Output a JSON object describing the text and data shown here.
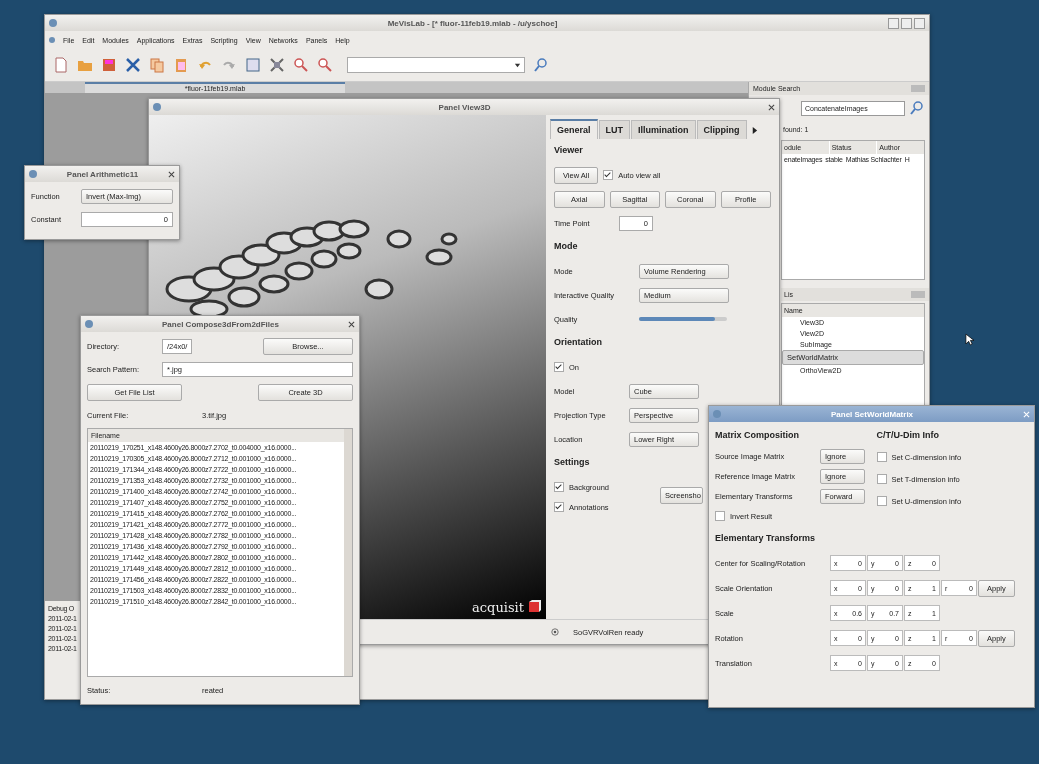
{
  "main_window": {
    "title": "MeVisLab - [* fluor-11feb19.mlab - /u/yschoe]",
    "menu": [
      "File",
      "Edit",
      "Modules",
      "Applications",
      "Extras",
      "Scripting",
      "View",
      "Networks",
      "Panels",
      "Help"
    ],
    "document_tab": "*fluor-11feb19.mlab",
    "debug_output": {
      "label": "Debug O",
      "lines": [
        "2011-02-1",
        "2011-02-1",
        "2011-02-1",
        "2011-02-1"
      ]
    }
  },
  "module_search": {
    "title": "Module Search",
    "query": "ConcatenateImages",
    "found": "found: 1",
    "columns": [
      "odule",
      "Status",
      "Author"
    ],
    "rows": [
      [
        "enateImages",
        "stable",
        "Mathias Schlachter",
        "H"
      ]
    ]
  },
  "module_list": {
    "title": "Lis",
    "columns": [
      "Name"
    ],
    "rows": [
      {
        "name": "View3D",
        "selected": false
      },
      {
        "name": "View2D",
        "selected": false
      },
      {
        "name": "SubImage",
        "selected": false
      },
      {
        "name": "SetWorldMatrix",
        "selected": true
      },
      {
        "name": "OrthoView2D",
        "selected": false
      }
    ]
  },
  "panel_view3d": {
    "title": "Panel View3D",
    "logo": "acquisit",
    "status": "SoGVRVolRen ready",
    "tabs": [
      {
        "label": "General",
        "selected": true
      },
      {
        "label": "LUT",
        "selected": false
      },
      {
        "label": "Illumination",
        "selected": false
      },
      {
        "label": "Clipping",
        "selected": false
      }
    ],
    "viewer": {
      "heading": "Viewer",
      "view_all": "View All",
      "auto_view_all": {
        "label": "Auto view all",
        "checked": true
      },
      "buttons": [
        "Axial",
        "Sagittal",
        "Coronal",
        "Profile"
      ],
      "time_point": {
        "label": "Time Point",
        "value": "0"
      }
    },
    "mode": {
      "heading": "Mode",
      "mode": {
        "label": "Mode",
        "value": "Volume Rendering"
      },
      "interactive_quality": {
        "label": "Interactive Quality",
        "value": "Medium"
      },
      "quality": {
        "label": "Quality",
        "level": 0.86
      }
    },
    "orientation": {
      "heading": "Orientation",
      "on": {
        "label": "On",
        "checked": true
      },
      "fields": [
        {
          "label": "Model",
          "value": "Cube"
        },
        {
          "label": "Projection Type",
          "value": "Perspective"
        },
        {
          "label": "Location",
          "value": "Lower Right"
        }
      ]
    },
    "settings": {
      "heading": "Settings",
      "checks": [
        {
          "label": "Background",
          "checked": true
        },
        {
          "label": "Annotations",
          "checked": true
        }
      ],
      "button": "Screensho"
    }
  },
  "panel_arithmetic": {
    "title": "Panel Arithmetic11",
    "function": {
      "label": "Function",
      "value": "Invert (Max-Img)"
    },
    "constant": {
      "label": "Constant",
      "value": "0"
    }
  },
  "panel_compose": {
    "title": "Panel Compose3dFrom2dFiles",
    "directory": {
      "label": "Directory:",
      "value": "/24x0/",
      "button": "Browse..."
    },
    "search_pattern": {
      "label": "Search Pattern:",
      "value": "*.jpg"
    },
    "buttons": [
      "Get File List",
      "Create 3D"
    ],
    "current_file": {
      "label": "Current File:",
      "value": "3.tif.jpg"
    },
    "list_header": "Filename",
    "files": [
      "20110219_170251_x148.4600y26.8000z7.2702_t0.004000_x16.0000...",
      "20110219_170305_x148.4600y26.8000z7.2712_t0.001000_x16.0000...",
      "20110219_171344_x148.4600y26.8000z7.2722_t0.001000_x16.0000...",
      "20110219_171353_x148.4600y26.8000z7.2732_t0.001000_x16.0000...",
      "20110219_171400_x148.4600y26.8000z7.2742_t0.001000_x16.0000...",
      "20110219_171407_x148.4600y26.8000z7.2752_t0.001000_x16.0000...",
      "20110219_171415_x148.4600y26.8000z7.2762_t0.001000_x16.0000...",
      "20110219_171421_x148.4600y26.8000z7.2772_t0.001000_x16.0000...",
      "20110219_171428_x148.4600y26.8000z7.2782_t0.001000_x16.0000...",
      "20110219_171436_x148.4600y26.8000z7.2792_t0.001000_x16.0000...",
      "20110219_171442_x148.4600y26.8000z7.2802_t0.001000_x16.0000...",
      "20110219_171449_x148.4600y26.8000z7.2812_t0.001000_x16.0000...",
      "20110219_171456_x148.4600y26.8000z7.2822_t0.001000_x16.0000...",
      "20110219_171503_x148.4600y26.8000z7.2832_t0.001000_x16.0000...",
      "20110219_171510_x148.4600y26.8000z7.2842_t0.001000_x16.0000..."
    ],
    "status": {
      "label": "Status:",
      "value": "reated"
    }
  },
  "panel_setworldmatrix": {
    "title": "Panel SetWorldMatrix",
    "composition": {
      "heading": "Matrix Composition",
      "fields": [
        {
          "label": "Source Image Matrix",
          "value": "Ignore"
        },
        {
          "label": "Reference Image Matrix",
          "value": "Ignore"
        },
        {
          "label": "Elementary Transforms",
          "value": "Forward"
        }
      ],
      "invert": {
        "label": "Invert Result",
        "checked": false
      }
    },
    "dim_info": {
      "heading": "C/T/U-Dim Info",
      "checks": [
        {
          "label": "Set C-dimension info",
          "checked": false
        },
        {
          "label": "Set T-dimension info",
          "checked": false
        },
        {
          "label": "Set U-dimension info",
          "checked": false
        }
      ]
    },
    "transforms": {
      "heading": "Elementary Transforms",
      "rows": [
        {
          "label": "Center for Scaling/Rotation",
          "fields": [
            {
              "axis": "x",
              "value": "0"
            },
            {
              "axis": "y",
              "value": "0"
            },
            {
              "axis": "z",
              "value": "0"
            }
          ]
        },
        {
          "label": "Scale Orientation",
          "fields": [
            {
              "axis": "x",
              "value": "0"
            },
            {
              "axis": "y",
              "value": "0"
            },
            {
              "axis": "z",
              "value": "1"
            },
            {
              "axis": "r",
              "value": "0"
            }
          ],
          "button": "Apply"
        },
        {
          "label": "Scale",
          "fields": [
            {
              "axis": "x",
              "value": "0.6"
            },
            {
              "axis": "y",
              "value": "0.7"
            },
            {
              "axis": "z",
              "value": "1"
            }
          ]
        },
        {
          "label": "Rotation",
          "fields": [
            {
              "axis": "x",
              "value": "0"
            },
            {
              "axis": "y",
              "value": "0"
            },
            {
              "axis": "z",
              "value": "1"
            },
            {
              "axis": "r",
              "value": "0"
            }
          ],
          "button": "Apply"
        },
        {
          "label": "Translation",
          "fields": [
            {
              "axis": "x",
              "value": "0"
            },
            {
              "axis": "y",
              "value": "0"
            },
            {
              "axis": "z",
              "value": "0"
            }
          ]
        }
      ]
    }
  }
}
